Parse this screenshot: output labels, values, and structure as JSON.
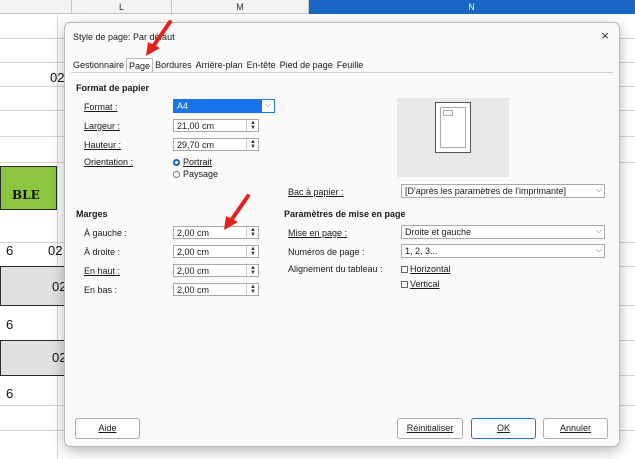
{
  "sheet": {
    "columns": [
      "L",
      "M",
      "N"
    ],
    "cells": {
      "a": "02",
      "b": "BLE",
      "c": "6",
      "d": "02",
      "e": "02",
      "f": "6",
      "g": "02",
      "h": "6"
    },
    "colors": {
      "selected_column": "#1a66c4",
      "green_cell": "#8cc63e",
      "gray_cell": "#e1e1e1"
    }
  },
  "dialog": {
    "title": "Style de page: Par défaut",
    "close_icon": "×",
    "tabs": [
      "Gestionnaire",
      "Page",
      "Bordures",
      "Arrière-plan",
      "En-tête",
      "Pied de page",
      "Feuille"
    ],
    "active_tab": "Page",
    "paper": {
      "section": "Format de papier",
      "format_label": "Format :",
      "format_value": "A4",
      "width_label": "Largeur :",
      "width_value": "21,00 cm",
      "height_label": "Hauteur :",
      "height_value": "29,70 cm",
      "orientation_label": "Orientation :",
      "portrait": "Portrait",
      "landscape": "Paysage",
      "tray_label": "Bac à papier :",
      "tray_value": "[D'après les paramètres de l'imprimante]"
    },
    "margins": {
      "section": "Marges",
      "left_label": "À gauche :",
      "left_value": "2,00 cm",
      "right_label": "À droite :",
      "right_value": "2,00 cm",
      "top_label": "En haut :",
      "top_value": "2,00 cm",
      "bottom_label": "En bas :",
      "bottom_value": "2,00 cm"
    },
    "layout": {
      "section": "Paramètres de mise en page",
      "layout_label": "Mise en page :",
      "layout_value": "Droite et gauche",
      "numbering_label": "Numéros de page :",
      "numbering_value": "1, 2, 3...",
      "align_label": "Alignement du tableau :",
      "horizontal": "Horizontal",
      "vertical": "Vertical"
    },
    "buttons": {
      "help": "Aide",
      "reset": "Réinitialiser",
      "ok": "OK",
      "cancel": "Annuler"
    },
    "accent": "#1565c0",
    "annotation_color": "#e8201a"
  }
}
